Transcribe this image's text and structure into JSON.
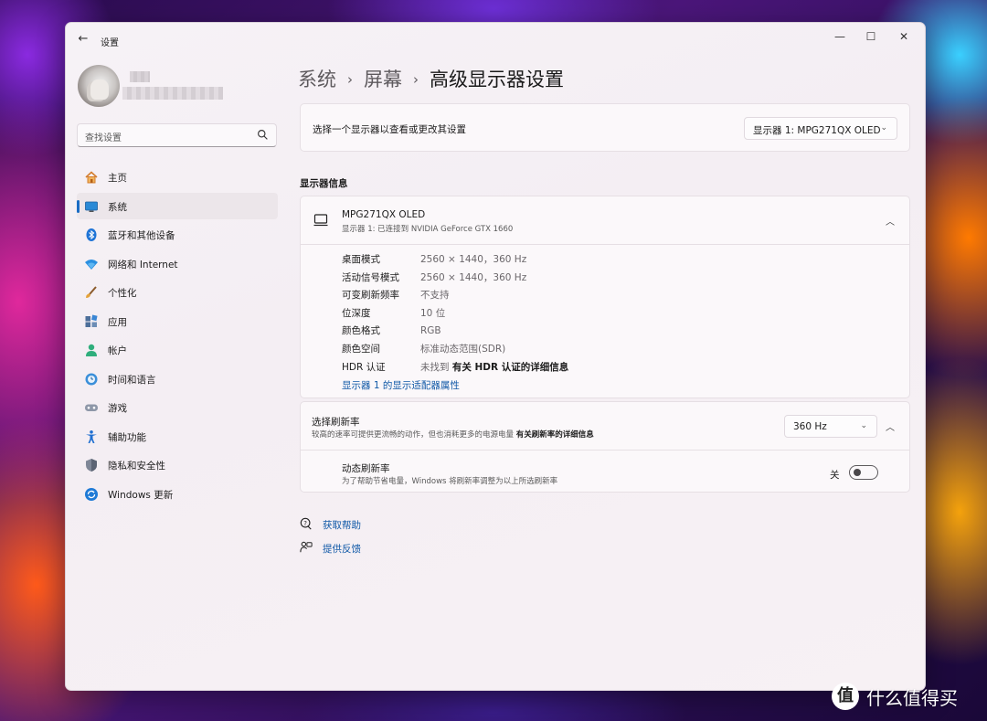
{
  "window": {
    "title": "设置",
    "back_glyph": "←",
    "min_glyph": "—",
    "max_glyph": "☐",
    "close_glyph": "✕"
  },
  "search": {
    "placeholder": "查找设置"
  },
  "sidebar": {
    "items": [
      {
        "label": "主页",
        "icon": "home-icon"
      },
      {
        "label": "系统",
        "icon": "system-icon"
      },
      {
        "label": "蓝牙和其他设备",
        "icon": "bluetooth-icon"
      },
      {
        "label": "网络和 Internet",
        "icon": "network-icon"
      },
      {
        "label": "个性化",
        "icon": "personalization-icon"
      },
      {
        "label": "应用",
        "icon": "apps-icon"
      },
      {
        "label": "帐户",
        "icon": "account-icon"
      },
      {
        "label": "时间和语言",
        "icon": "time-language-icon"
      },
      {
        "label": "游戏",
        "icon": "gaming-icon"
      },
      {
        "label": "辅助功能",
        "icon": "accessibility-icon"
      },
      {
        "label": "隐私和安全性",
        "icon": "privacy-shield-icon"
      },
      {
        "label": "Windows 更新",
        "icon": "windows-update-icon"
      }
    ],
    "active_index": 1
  },
  "breadcrumb": {
    "part1": "系统",
    "part2": "屏幕",
    "part3": "高级显示器设置",
    "separator": "›"
  },
  "display_select": {
    "label": "选择一个显示器以查看或更改其设置",
    "value": "显示器 1: MPG271QX OLED"
  },
  "display_info": {
    "section_title": "显示器信息",
    "monitor_name": "MPG271QX OLED",
    "monitor_sub": "显示器 1: 已连接到 NVIDIA GeForce GTX 1660",
    "rows": [
      {
        "key": "桌面模式",
        "value": "2560 × 1440，360 Hz"
      },
      {
        "key": "活动信号模式",
        "value": "2560 × 1440，360 Hz"
      },
      {
        "key": "可变刷新频率",
        "value": "不支持"
      },
      {
        "key": "位深度",
        "value": "10 位"
      },
      {
        "key": "颜色格式",
        "value": "RGB"
      },
      {
        "key": "颜色空间",
        "value": "标准动态范围(SDR)"
      },
      {
        "key": "HDR 认证",
        "value": "未找到",
        "link": "有关 HDR 认证的详细信息"
      }
    ],
    "adapter_link": "显示器 1 的显示适配器属性"
  },
  "refresh": {
    "title": "选择刷新率",
    "subtitle": "较高的速率可提供更流畅的动作，但也消耗更多的电源电量",
    "subtitle_link": "有关刷新率的详细信息",
    "value": "360 Hz",
    "dynamic_title": "动态刷新率",
    "dynamic_subtitle": "为了帮助节省电量，Windows 将刷新率调整为以上所选刷新率",
    "toggle_label": "关",
    "toggle_on": false
  },
  "help": {
    "get_help": "获取帮助",
    "feedback": "提供反馈"
  },
  "watermark": {
    "glyph": "值",
    "text": "什么值得买"
  },
  "colors": {
    "accent": "#1a6cc4",
    "link": "#125aa8"
  }
}
